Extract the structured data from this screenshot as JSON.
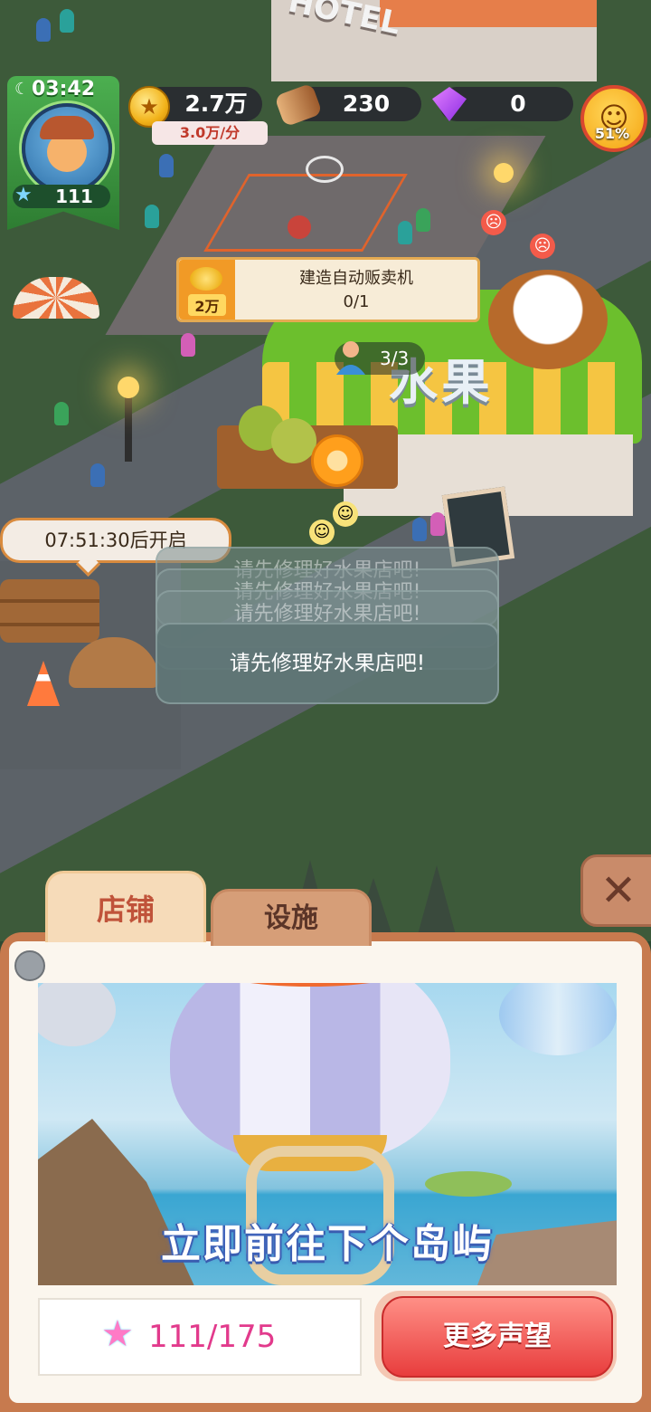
{
  "hud": {
    "timer": "03:42",
    "player_level": "111",
    "coins": "2.7万",
    "coin_rate": "3.0万/分",
    "wood": "230",
    "gems": "0",
    "happiness": "51%",
    "icons": {
      "moon": "moon-icon",
      "coin": "coin-icon",
      "wood": "wood-log-icon",
      "gem": "gem-icon",
      "mood": "smiley-face-icon",
      "level_star": "star-icon"
    }
  },
  "scene": {
    "hotel_sign": "HOTEL",
    "shop_sign": "水果",
    "build_task": {
      "title": "建造自动贩卖机",
      "progress": "0/1",
      "cost": "2万"
    },
    "workers": "3/3",
    "countdown": "07:51:30后开启"
  },
  "toast": {
    "message": "请先修理好水果店吧!"
  },
  "panel": {
    "tabs": [
      {
        "label": "店铺",
        "active": true
      },
      {
        "label": "设施",
        "active": false
      }
    ],
    "banner_caption": "立即前往下个岛屿",
    "reputation": "111/175",
    "more_reputation_button": "更多声望",
    "close_icon": "close-icon"
  },
  "colors": {
    "accent_orange": "#e4aa52",
    "button_red": "#e83d3d",
    "reputation_pink": "#e23a8c",
    "tab_text": "#c0533a",
    "hud_green": "#4caf50"
  }
}
